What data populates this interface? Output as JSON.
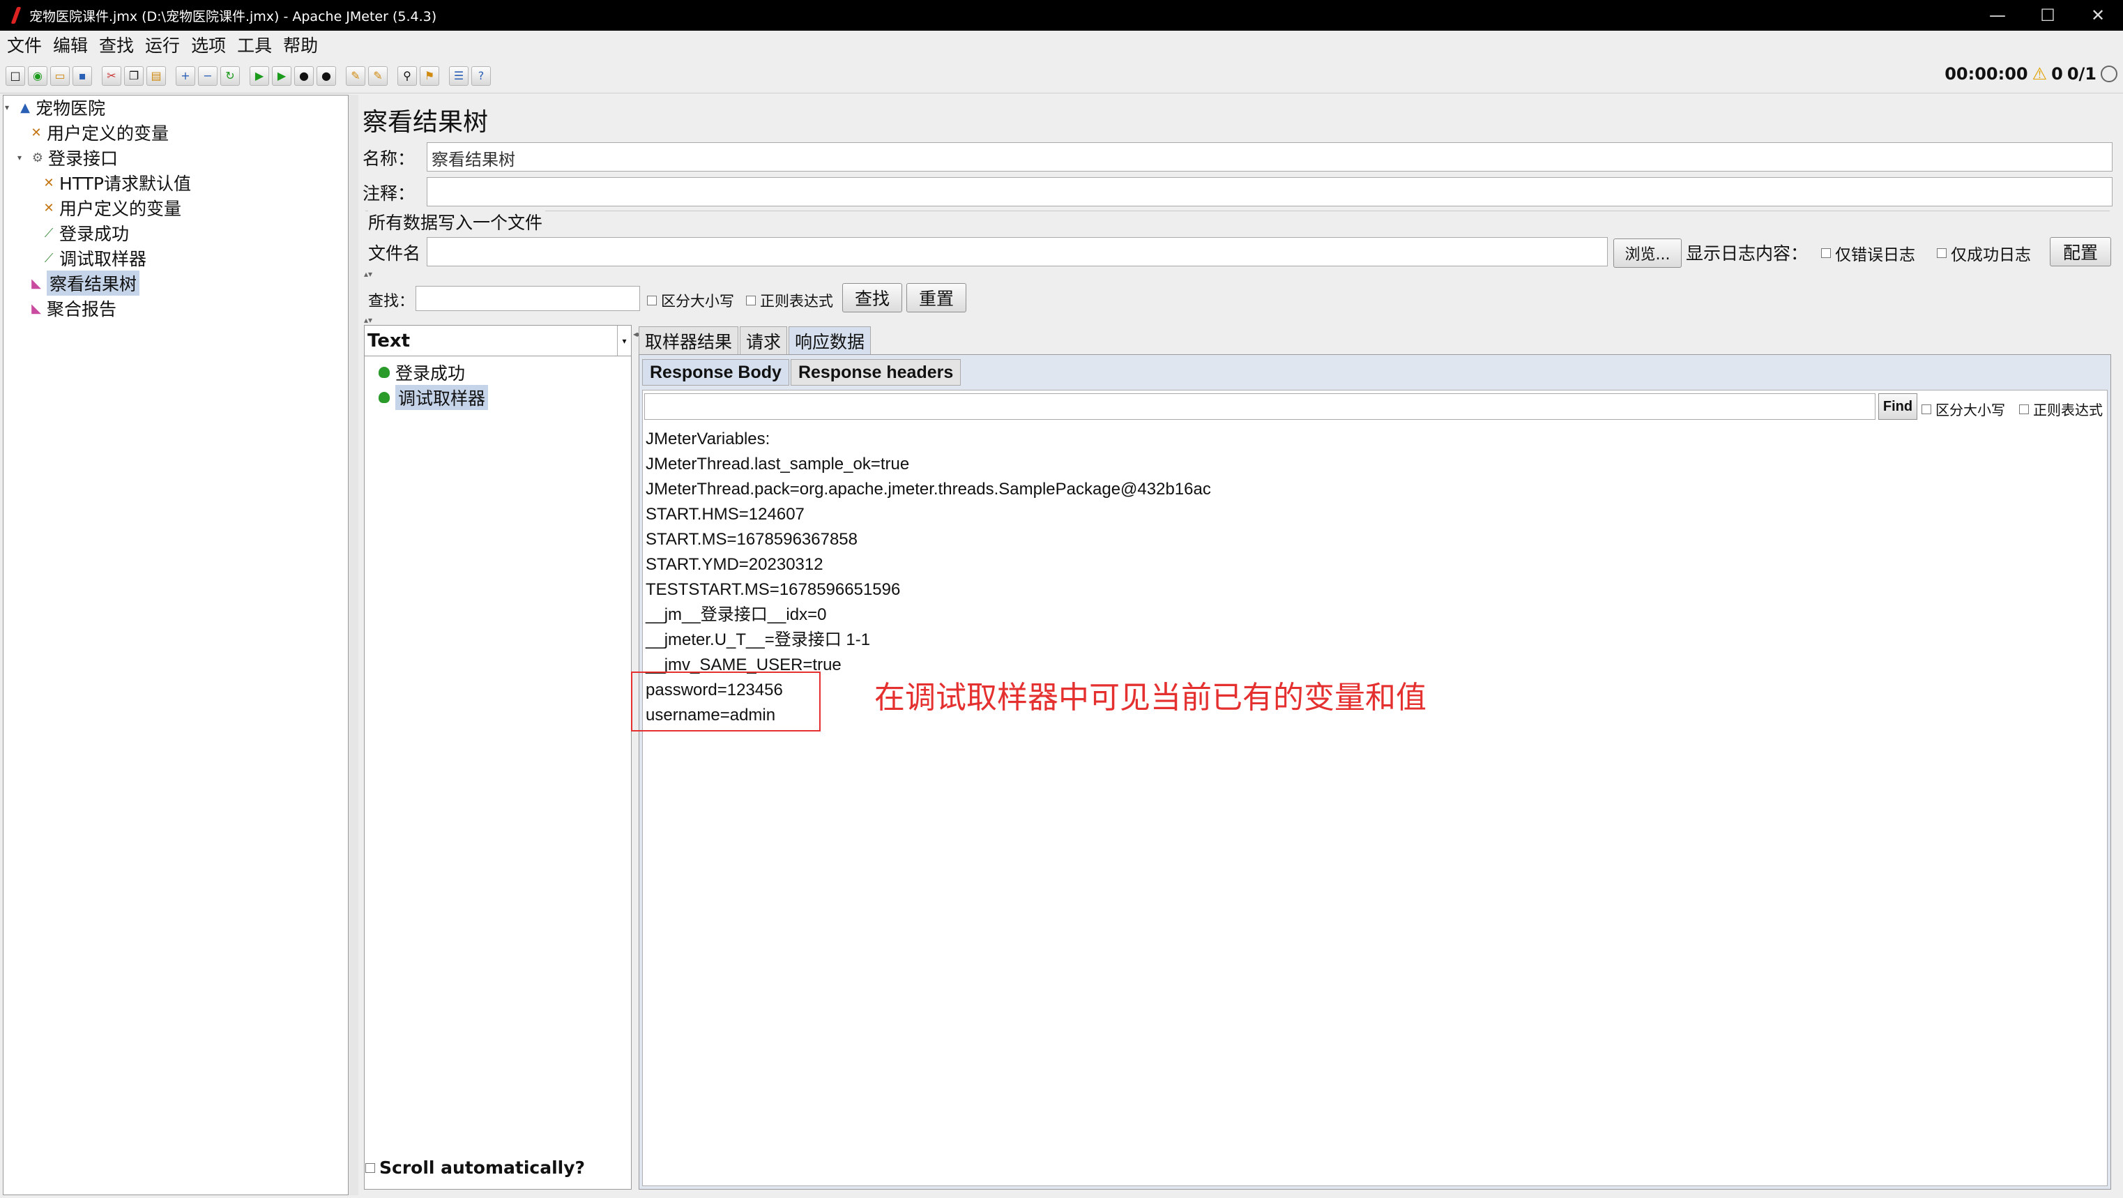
{
  "window": {
    "title": "宠物医院课件.jmx (D:\\宠物医院课件.jmx) - Apache JMeter (5.4.3)",
    "controls": [
      "—",
      "☐",
      "✕"
    ]
  },
  "menu": [
    "文件",
    "编辑",
    "查找",
    "运行",
    "选项",
    "工具",
    "帮助"
  ],
  "status": {
    "time": "00:00:00",
    "warnings": "0",
    "threads": "0/1"
  },
  "tree": [
    {
      "label": "宠物医院",
      "level": 0,
      "icon": "test-plan-icon",
      "expanded": true
    },
    {
      "label": "用户定义的变量",
      "level": 1,
      "icon": "config-icon"
    },
    {
      "label": "登录接口",
      "level": 1,
      "icon": "thread-group-icon",
      "expanded": true
    },
    {
      "label": "HTTP请求默认值",
      "level": 2,
      "icon": "config-icon"
    },
    {
      "label": "用户定义的变量",
      "level": 2,
      "icon": "config-icon"
    },
    {
      "label": "登录成功",
      "level": 2,
      "icon": "sampler-icon"
    },
    {
      "label": "调试取样器",
      "level": 2,
      "icon": "sampler-icon"
    },
    {
      "label": "察看结果树",
      "level": 1,
      "icon": "listener-icon",
      "selected": true
    },
    {
      "label": "聚合报告",
      "level": 1,
      "icon": "listener-icon"
    }
  ],
  "panel": {
    "title": "察看结果树",
    "name_label": "名称：",
    "name_value": "察看结果树",
    "comment_label": "注释：",
    "comment_value": "",
    "file_section": "所有数据写入一个文件",
    "filename_label": "文件名",
    "browse_button": "浏览...",
    "log_label": "显示日志内容：",
    "errors_only": "仅错误日志",
    "success_only": "仅成功日志",
    "config_button": "配置",
    "search_label": "查找：",
    "case_sensitive": "区分大小写",
    "regex": "正则表达式",
    "search_button": "查找",
    "reset_button": "重置"
  },
  "results": {
    "renderer": "Text",
    "items": [
      {
        "label": "登录成功",
        "selected": false
      },
      {
        "label": "调试取样器",
        "selected": true
      }
    ],
    "scroll_auto": "Scroll automatically?"
  },
  "tabs": [
    "取样器结果",
    "请求",
    "响应数据"
  ],
  "subtabs": [
    "Response Body",
    "Response headers"
  ],
  "find": {
    "button": "Find",
    "case_sensitive": "区分大小写",
    "regex": "正则表达式"
  },
  "response_lines": [
    "JMeterVariables:",
    "JMeterThread.last_sample_ok=true",
    "JMeterThread.pack=org.apache.jmeter.threads.SamplePackage@432b16ac",
    "START.HMS=124607",
    "START.MS=1678596367858",
    "START.YMD=20230312",
    "TESTSTART.MS=1678596651596",
    "__jm__登录接口__idx=0",
    "__jmeter.U_T__=登录接口 1-1",
    "__jmv_SAME_USER=true",
    "password=123456",
    "username=admin"
  ],
  "annotation": "在调试取样器中可见当前已有的变量和值",
  "colors": {
    "annotation": "#e53030",
    "selection": "#c5d4e8"
  }
}
